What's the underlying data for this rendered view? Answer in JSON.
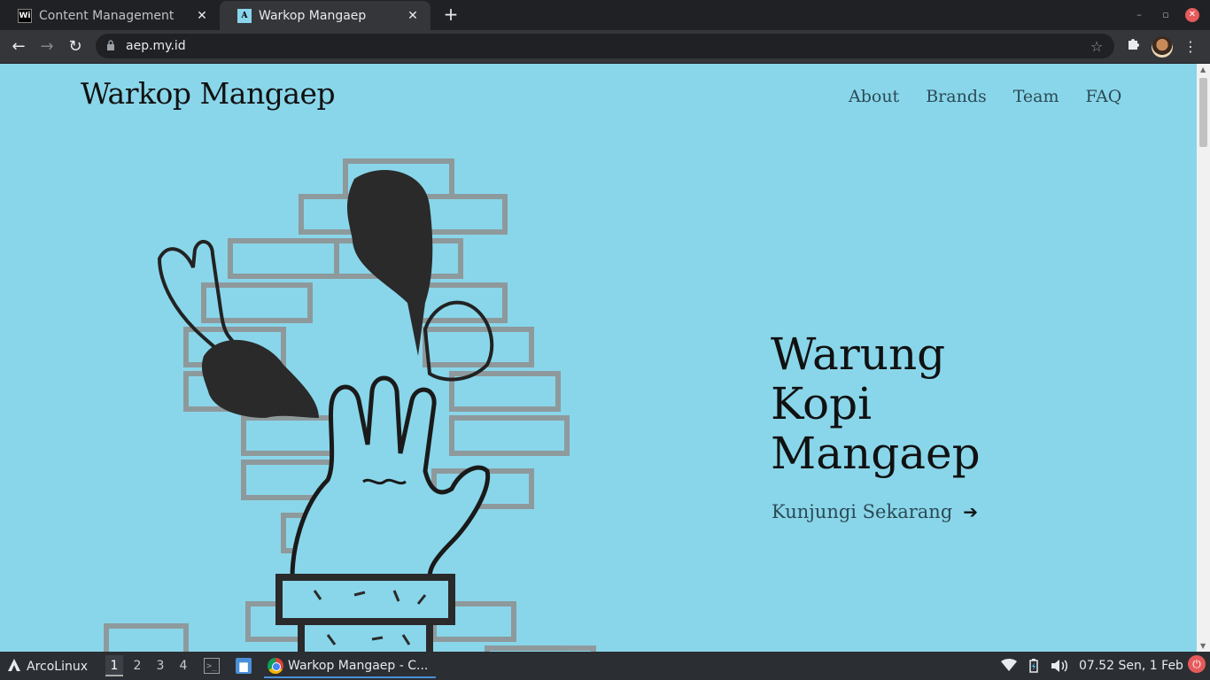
{
  "browser": {
    "tabs": [
      {
        "title": "Content Management",
        "favicon": "Wi",
        "active": false
      },
      {
        "title": "Warkop Mangaep",
        "favicon": "A",
        "active": true
      }
    ],
    "new_tab_label": "+",
    "url": "aep.my.id",
    "icons": {
      "back": "←",
      "forward": "→",
      "reload": "↻",
      "lock": "🔒",
      "star": "☆",
      "extensions": "✚",
      "menu": "⋮",
      "close": "✕",
      "minimize": "–",
      "maximize": "▫",
      "window_close": "✕"
    }
  },
  "site": {
    "logo": "Warkop Mangaep",
    "nav": [
      "About",
      "Brands",
      "Team",
      "FAQ"
    ],
    "hero": {
      "title_lines": [
        "Warung",
        "Kopi",
        "Mangaep"
      ],
      "cta_label": "Kunjungi Sekarang",
      "cta_arrow": "➔"
    },
    "colors": {
      "background": "#89d6ea",
      "ink": "#111111",
      "nav": "#2b4a55"
    }
  },
  "taskbar": {
    "start_label": "ArcoLinux",
    "workspaces": [
      "1",
      "2",
      "3",
      "4"
    ],
    "active_workspace": "1",
    "task_label": "Warkop Mangaep - C...",
    "clock": "07.52 Sen, 1 Feb"
  }
}
